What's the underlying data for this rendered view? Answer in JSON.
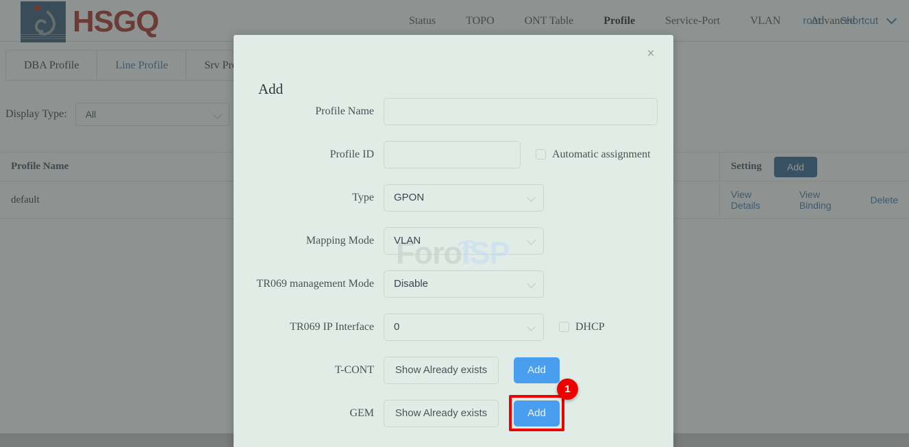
{
  "brand": {
    "name": "HSGQ"
  },
  "nav": {
    "items": [
      {
        "label": "Status",
        "active": false
      },
      {
        "label": "TOPO",
        "active": false
      },
      {
        "label": "ONT Table",
        "active": false
      },
      {
        "label": "Profile",
        "active": true
      },
      {
        "label": "Service-Port",
        "active": false
      },
      {
        "label": "VLAN",
        "active": false
      },
      {
        "label": "Advanced",
        "active": false
      }
    ],
    "user": "root",
    "shortcut": "Shortcut"
  },
  "tabs": [
    {
      "label": "DBA Profile",
      "active": false
    },
    {
      "label": "Line Profile",
      "active": true
    },
    {
      "label": "Srv Profile",
      "active": false
    }
  ],
  "filters": {
    "display_type_label": "Display Type:",
    "display_type_value": "All"
  },
  "table": {
    "columns": [
      "Profile Name",
      "Setting"
    ],
    "header_add_button": "Add",
    "rows": [
      {
        "profile_name": "default",
        "actions": [
          "View Details",
          "View Binding",
          "Delete"
        ]
      }
    ]
  },
  "modal": {
    "title": "Add",
    "close_icon": "×",
    "fields": {
      "profile_name_label": "Profile Name",
      "profile_name_value": "",
      "profile_name_placeholder": "",
      "profile_id_label": "Profile ID",
      "profile_id_value": "",
      "profile_id_placeholder": "",
      "auto_assign_label": "Automatic assignment",
      "auto_assign_checked": false,
      "type_label": "Type",
      "type_value": "GPON",
      "mapping_mode_label": "Mapping Mode",
      "mapping_mode_value": "VLAN",
      "tr069_mode_label": "TR069 management Mode",
      "tr069_mode_value": "Disable",
      "tr069_ip_label": "TR069 IP Interface",
      "tr069_ip_value": "0",
      "dhcp_label": "DHCP",
      "dhcp_checked": false,
      "tcont_label": "T-CONT",
      "tcont_show_button": "Show Already exists",
      "tcont_add_button": "Add",
      "gem_label": "GEM",
      "gem_show_button": "Show Already exists",
      "gem_add_button": "Add"
    }
  },
  "annotation": {
    "step_number": "1",
    "target": "gem-add-button"
  },
  "watermark": {
    "part1": "Foro",
    "part2": "ISP"
  },
  "colors": {
    "brand_red": "#a8241b",
    "brand_blue": "#2d4f72",
    "link_blue": "#3b6ea5",
    "button_blue": "#4a9ef0",
    "dark_button_blue": "#2c5a8f",
    "modal_bg": "#e0ece5",
    "highlight_red": "#ef0000"
  }
}
